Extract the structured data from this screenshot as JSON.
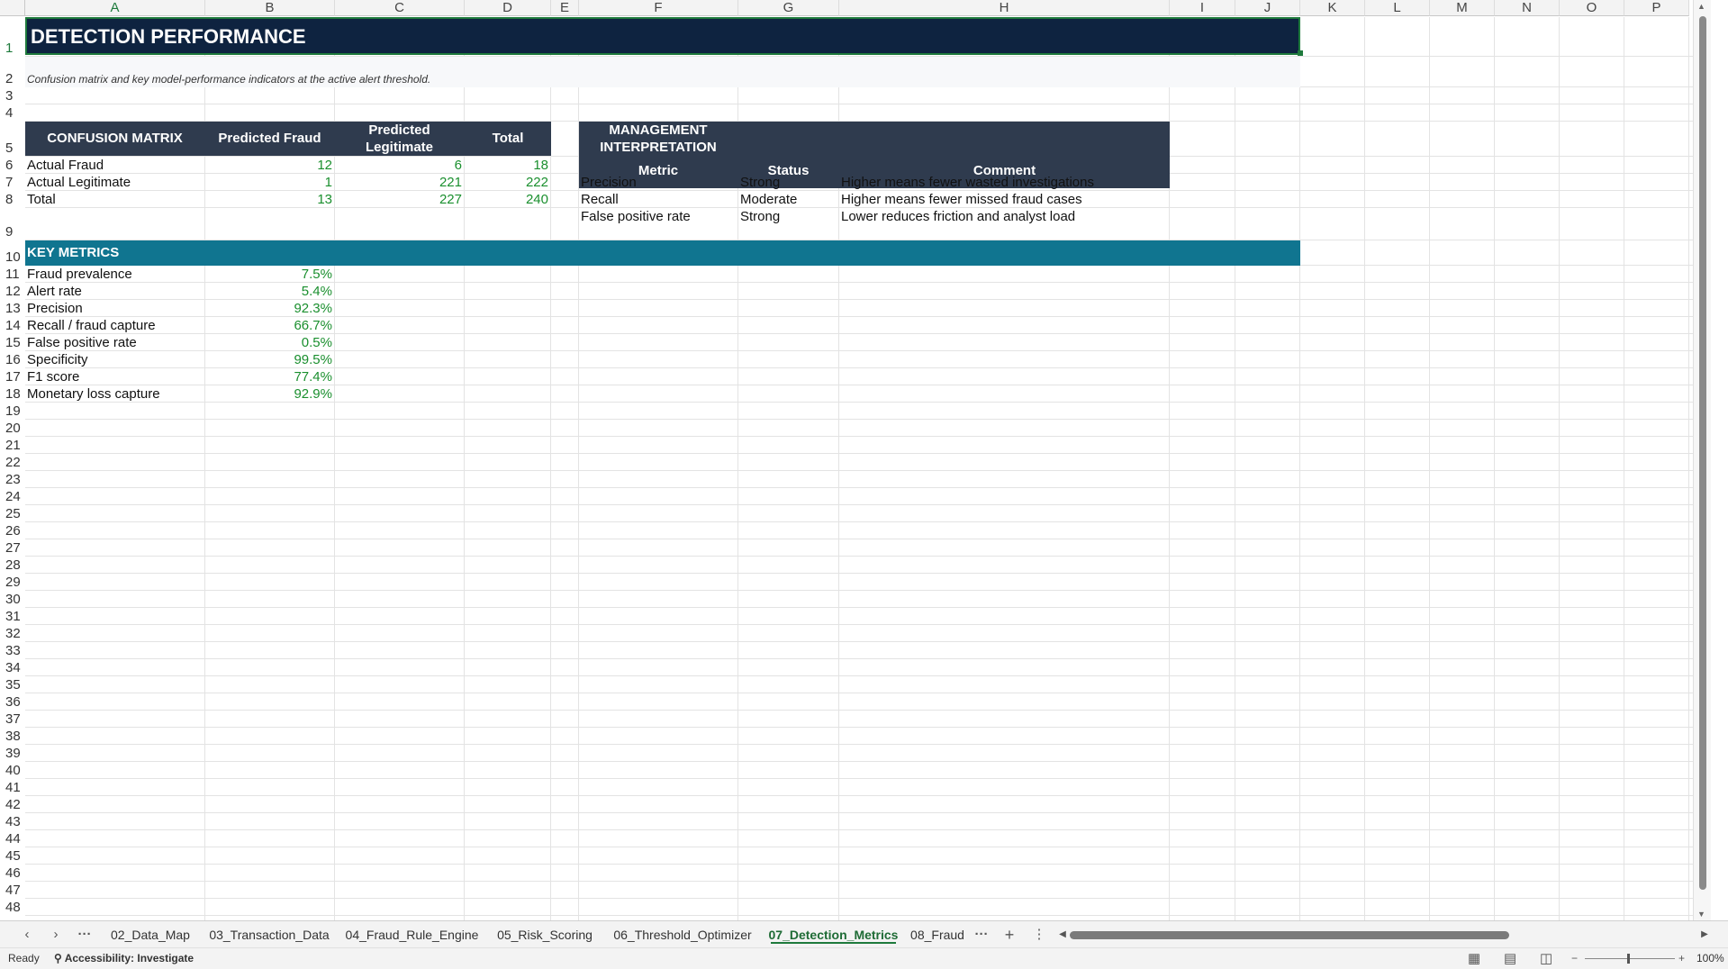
{
  "columns": [
    "A",
    "B",
    "C",
    "D",
    "E",
    "F",
    "G",
    "H",
    "I",
    "J",
    "K",
    "L",
    "M",
    "N",
    "O",
    "P"
  ],
  "rows": [
    "1",
    "2",
    "3",
    "4",
    "5",
    "6",
    "7",
    "8",
    "9",
    "10",
    "11",
    "12",
    "13",
    "14",
    "15",
    "16",
    "17",
    "18",
    "19",
    "20",
    "21",
    "22",
    "23",
    "24",
    "25",
    "26",
    "27",
    "28",
    "29",
    "30",
    "31",
    "32",
    "33",
    "34",
    "35",
    "36",
    "37",
    "38",
    "39",
    "40",
    "41",
    "42",
    "43",
    "44",
    "45",
    "46",
    "47",
    "48"
  ],
  "title": "DETECTION PERFORMANCE",
  "subtitle": "Confusion matrix and key model-performance indicators at the active alert threshold.",
  "confusion": {
    "header_label": "CONFUSION MATRIX",
    "col_pred_fraud": "Predicted Fraud",
    "col_pred_legit": "Predicted Legitimate",
    "col_total": "Total",
    "rows": [
      {
        "label": "Actual Fraud",
        "pred_fraud": "12",
        "pred_legit": "6",
        "total": "18"
      },
      {
        "label": "Actual Legitimate",
        "pred_fraud": "1",
        "pred_legit": "221",
        "total": "222"
      },
      {
        "label": "Total",
        "pred_fraud": "13",
        "pred_legit": "227",
        "total": "240"
      }
    ]
  },
  "management": {
    "header": "MANAGEMENT INTERPRETATION",
    "col_metric": "Metric",
    "col_status": "Status",
    "col_comment": "Comment",
    "rows": [
      {
        "metric": "Precision",
        "status": "Strong",
        "comment": "Higher means fewer wasted investigations"
      },
      {
        "metric": "Recall",
        "status": "Moderate",
        "comment": "Higher means fewer missed fraud cases"
      },
      {
        "metric": "False positive rate",
        "status": "Strong",
        "comment": "Lower reduces friction and analyst load"
      }
    ]
  },
  "key_metrics": {
    "header": "KEY METRICS",
    "rows": [
      {
        "label": "Fraud prevalence",
        "value": "7.5%"
      },
      {
        "label": "Alert rate",
        "value": "5.4%"
      },
      {
        "label": "Precision",
        "value": "92.3%"
      },
      {
        "label": "Recall / fraud capture",
        "value": "66.7%"
      },
      {
        "label": "False positive rate",
        "value": "0.5%"
      },
      {
        "label": "Specificity",
        "value": "99.5%"
      },
      {
        "label": "F1 score",
        "value": "77.4%"
      },
      {
        "label": "Monetary loss capture",
        "value": "92.9%"
      }
    ]
  },
  "tabs": {
    "items": [
      "02_Data_Map",
      "03_Transaction_Data",
      "04_Fraud_Rule_Engine",
      "05_Risk_Scoring",
      "06_Threshold_Optimizer",
      "07_Detection_Metrics",
      "08_Fraud"
    ],
    "active": "07_Detection_Metrics",
    "more": "···",
    "add": "+"
  },
  "status": {
    "ready": "Ready",
    "accessibility": "Accessibility: Investigate",
    "zoom": "100%"
  },
  "colors": {
    "title_band": "#0e2340",
    "slate_header": "#2f3b4e",
    "teal_header": "#107590",
    "number_green": "#1a8f2e",
    "active_tab": "#1e7a3c"
  }
}
